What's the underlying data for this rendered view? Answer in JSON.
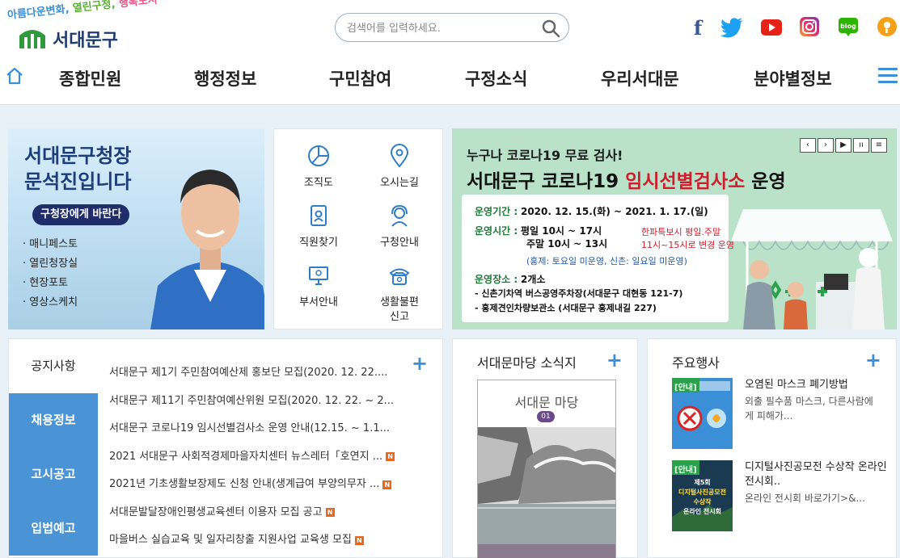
{
  "header": {
    "slogan": {
      "part1": "아름다운변화,",
      "part2": " 열린구정,",
      "part3": " 행복도시"
    },
    "logo_text": "서대문구",
    "search_placeholder": "검색어를 입력하세요.",
    "sns": [
      {
        "name": "facebook-icon",
        "color": "#3b5998"
      },
      {
        "name": "twitter-icon",
        "color": "#1da1f2"
      },
      {
        "name": "youtube-icon",
        "color": "#e62117"
      },
      {
        "name": "instagram-icon",
        "color": "#c13584"
      },
      {
        "name": "blog-icon",
        "color": "#2db400",
        "label": "blog"
      },
      {
        "name": "kakaostory-icon",
        "color": "#f6a01a"
      }
    ]
  },
  "gnb": {
    "items": [
      "종합민원",
      "행정정보",
      "구민참여",
      "구정소식",
      "우리서대문",
      "분야별정보"
    ]
  },
  "mayor": {
    "title_line1": "서대문구청장",
    "title_line2": "문석진입니다",
    "button": "구청장에게 바란다",
    "links": [
      "매니페스토",
      "열린청장실",
      "현장포토",
      "영상스케치"
    ]
  },
  "quick_links": [
    {
      "label": "조직도",
      "icon": "pie-chart-icon"
    },
    {
      "label": "오시는길",
      "icon": "map-pin-icon"
    },
    {
      "label": "직원찾기",
      "icon": "id-badge-icon"
    },
    {
      "label": "구청안내",
      "icon": "headset-icon"
    },
    {
      "label": "부서안내",
      "icon": "monitor-icon"
    },
    {
      "label": "생활불편",
      "label2": "신고",
      "icon": "phone-icon"
    }
  ],
  "covid_banner": {
    "sub": "누구나 코로나19 무료 검사!",
    "main_prefix": "서대문구 코로나19 ",
    "main_red": "임시선별검사소",
    "main_suffix": " 운영",
    "period_key": "운영기간 :",
    "period_val": "2020. 12. 15.(화) ~ 2021. 1. 17.(일)",
    "hours_key": "운영시간 :",
    "hours_weekday": "평일 10시 ~ 17시",
    "hours_weekend": "주말 10시 ~ 13시",
    "note_red1": "한파특보시 평일.주말",
    "note_red2": "11시~15시로 변경 운영",
    "note_blue": "(홍제: 토요일 미운영, 신촌: 일요일 미운영)",
    "place_key": "운영장소 :",
    "place_val": "2개소",
    "place1": "- 신촌기차역 버스공영주차장(서대문구 대현동 121-7)",
    "place2": "- 홍제견인차량보관소 (서대문구 홍제내길 227)",
    "controls": [
      "‹",
      "›",
      "▶",
      "ıı",
      "≡"
    ]
  },
  "notice": {
    "tabs": [
      "공지사항",
      "채용정보",
      "고시공고",
      "입법예고"
    ],
    "items": [
      {
        "title": "서대문구 제1기 주민참여예산제 홍보단 모집(2020. 12. 22....",
        "new": false
      },
      {
        "title": "서대문구 제11기 주민참여예산위원 모집(2020. 12. 22. ~ 2...",
        "new": false
      },
      {
        "title": "서대문구 코로나19 임시선별검사소 운영 안내(12.15. ~ 1.1...",
        "new": false
      },
      {
        "title": "2021 서대문구 사회적경제마을자치센터 뉴스레터「호연지 ...",
        "new": true
      },
      {
        "title": "2021년 기초생활보장제도 신청 안내(생계급여 부양의무자 ...",
        "new": true
      },
      {
        "title": "서대문발달장애인평생교육센터 이용자 모집 공고",
        "new": true
      },
      {
        "title": "마을버스 실습교육 및 일자리창출 지원사업 교육생 모집",
        "new": true
      }
    ],
    "new_badge": "N"
  },
  "magazine": {
    "title": "서대문마당 소식지",
    "cover_title": "서대문 마당",
    "cover_issue": "01"
  },
  "events": {
    "title": "주요행사",
    "items": [
      {
        "tag": "[안내]",
        "title": "오염된 마스크 폐기방법",
        "desc": "외출 필수품 마스크, 다른사람에게 피해가..."
      },
      {
        "tag": "[안내]",
        "title": "디지털사진공모전 수상작 온라인 전시회..",
        "desc": "온라인 전시회 바로가기>&...",
        "thumb_lines": [
          "제5회",
          "디지털사진공모전",
          "수상작",
          "온라인 전시회"
        ]
      }
    ]
  },
  "plus_label": "+"
}
